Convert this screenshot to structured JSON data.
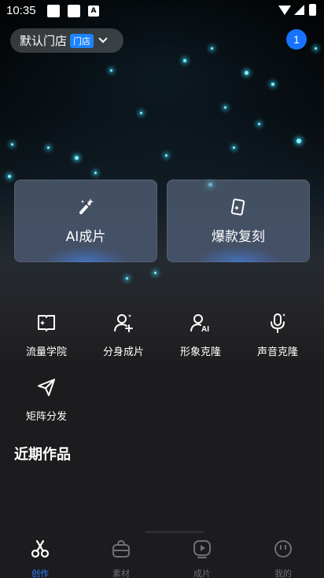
{
  "status_bar": {
    "time": "10:35"
  },
  "header": {
    "store_name": "默认门店",
    "store_tag": "门店",
    "notification_count": "1"
  },
  "feature_cards": [
    {
      "label": "AI成片",
      "icon": "magic-wand-icon"
    },
    {
      "label": "爆款复刻",
      "icon": "cards-icon"
    }
  ],
  "tools": [
    {
      "label": "流量学院",
      "icon": "book-icon"
    },
    {
      "label": "分身成片",
      "icon": "user-add-icon"
    },
    {
      "label": "形象克隆",
      "icon": "user-ai-icon"
    },
    {
      "label": "声音克隆",
      "icon": "microphone-icon"
    },
    {
      "label": "矩阵分发",
      "icon": "send-icon"
    }
  ],
  "recent": {
    "title": "近期作品"
  },
  "bottom_nav": [
    {
      "label": "创作",
      "icon": "scissors-icon",
      "active": true
    },
    {
      "label": "素材",
      "icon": "bag-icon",
      "active": false
    },
    {
      "label": "成片",
      "icon": "video-icon",
      "active": false
    },
    {
      "label": "我的",
      "icon": "face-icon",
      "active": false
    }
  ],
  "colors": {
    "accent": "#2f82ff",
    "badge": "#1673ff",
    "store_tag": "#1d84ff",
    "star": "#7ff3ff"
  }
}
